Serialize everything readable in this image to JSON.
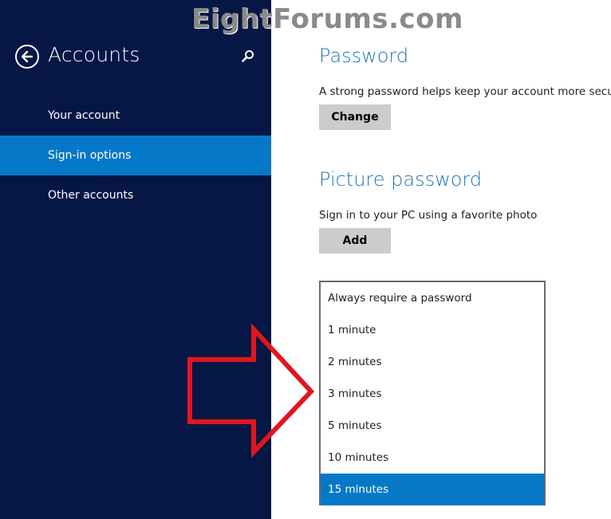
{
  "watermark": "EightForums.com",
  "sidebar": {
    "title": "Accounts",
    "back_icon": "back-arrow-circle-icon",
    "search_icon": "search-icon",
    "items": [
      {
        "label": "Your account",
        "active": false
      },
      {
        "label": "Sign-in options",
        "active": true
      },
      {
        "label": "Other accounts",
        "active": false
      }
    ]
  },
  "password": {
    "heading": "Password",
    "description": "A strong password helps keep your account more secure",
    "button_label": "Change"
  },
  "picture_password": {
    "heading": "Picture password",
    "description": "Sign in to your PC using a favorite photo",
    "button_label": "Add"
  },
  "require_password_dropdown": {
    "options": [
      "Always require a password",
      "1 minute",
      "2 minutes",
      "3 minutes",
      "5 minutes",
      "10 minutes",
      "15 minutes"
    ],
    "selected": "15 minutes"
  },
  "annotation": {
    "icon": "red-arrow-right-icon",
    "color": "#e0161d"
  },
  "colors": {
    "sidebar_bg": "#061746",
    "accent": "#0678c8",
    "heading": "#1f74b4",
    "button_bg": "#cccccc"
  }
}
